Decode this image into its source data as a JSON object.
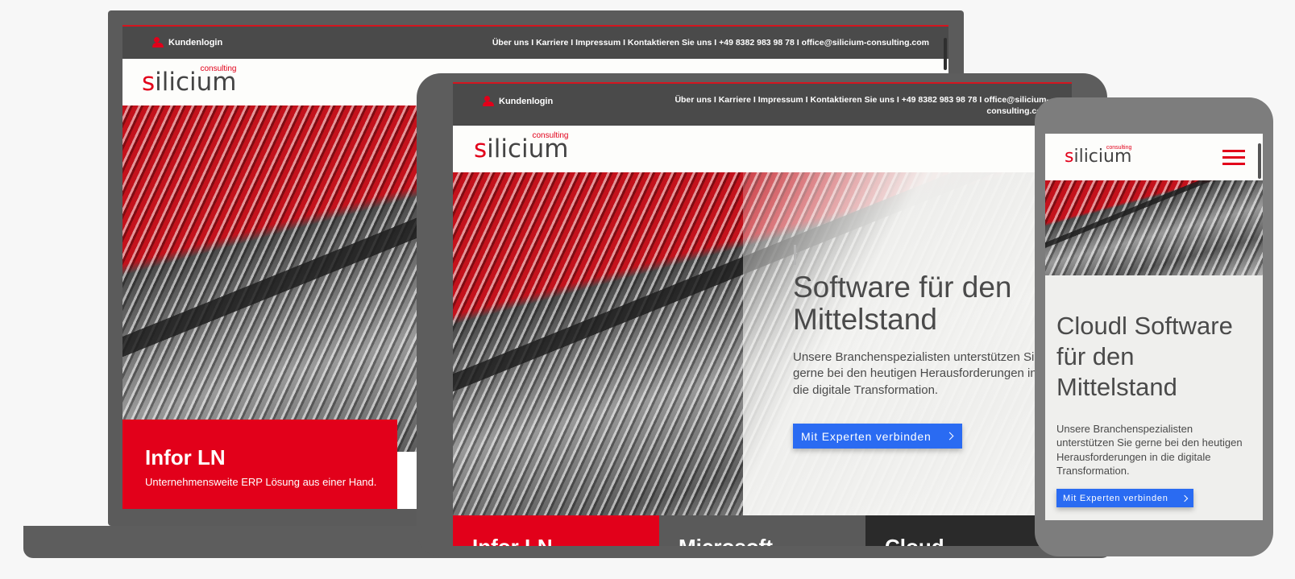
{
  "colors": {
    "brand_red": "#e2001a",
    "topbar": "#4a4a4a",
    "cta_blue": "#2a6bf2",
    "tile_gray": "#5a5a5a",
    "tile_dark": "#2a2a2a"
  },
  "topbar": {
    "login_label": "Kundenlogin",
    "links_full": "Über uns I Karriere I Impressum I Kontaktieren Sie uns I +49 8382 983 98 78 I office@silicium-consulting.com",
    "links_tablet_line1": "Über uns I Karriere I Impressum I Kontaktieren Sie uns I +49 8382 983 98 78 I office@silicium-",
    "links_tablet_line2": "consulting.com"
  },
  "logo": {
    "first_letter": "s",
    "rest": "ilicium",
    "superscript": "consulting"
  },
  "hero": {
    "title_tablet": "Software für den Mittelstand",
    "title_phone": "Cloudl Software für den Mittelstand",
    "lead": "Unsere Branchenspezialisten unterstützen Sie gerne bei den heutigen Herausforderungen in die digitale Transformation.",
    "cta_label": "Mit Experten verbinden"
  },
  "laptop_tile": {
    "title": "Infor LN",
    "subtitle": "Unternehmensweite ERP Lösung aus einer Hand."
  },
  "tablet_tiles": [
    {
      "title": "Infor LN"
    },
    {
      "title": "Microsoft"
    },
    {
      "title": "Cloud"
    }
  ],
  "icons": {
    "login": "user-icon",
    "menu": "hamburger-menu-icon",
    "cta": "chevron-right-icon"
  }
}
